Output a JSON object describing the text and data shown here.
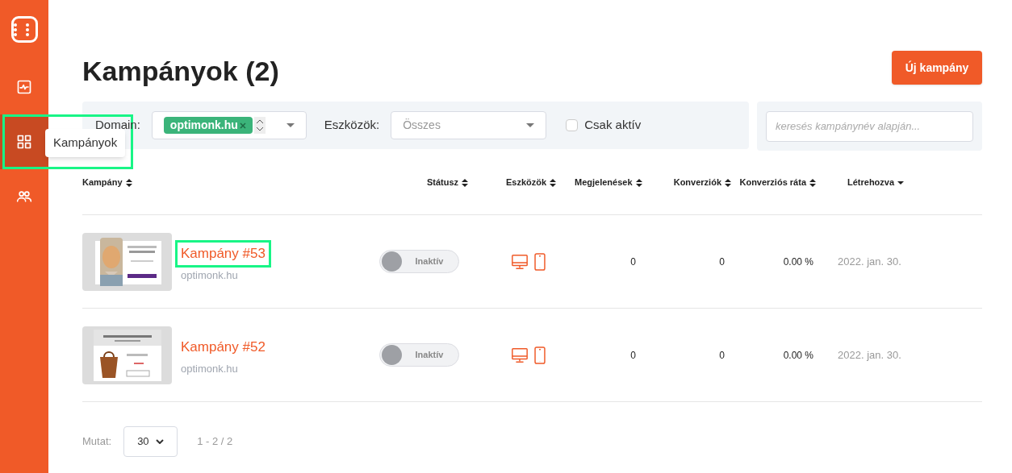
{
  "sidebar": {
    "items": [
      {
        "kind": "analytics",
        "selected": false
      },
      {
        "kind": "campaigns",
        "selected": true
      },
      {
        "kind": "users",
        "selected": false
      }
    ],
    "tooltip": "Kampányok"
  },
  "page": {
    "title": "Kampányok (2)",
    "new_button": "Új kampány"
  },
  "filters": {
    "domain_label": "Domain:",
    "domain_tag": "optimonk.hu",
    "devices_label": "Eszközök:",
    "devices_placeholder": "Összes",
    "only_active": {
      "label": "Csak aktív",
      "checked": false
    },
    "search_placeholder": "keresés kampánynév alapján..."
  },
  "table": {
    "columns": [
      {
        "label": "Kampány",
        "kind": "sortable"
      },
      {
        "label": "Státusz",
        "kind": "sortable"
      },
      {
        "label": "Eszközök",
        "kind": "sortable"
      },
      {
        "label": "Megjelenések",
        "kind": "sortable"
      },
      {
        "label": "Konverziók",
        "kind": "sortable"
      },
      {
        "label": "Konverziós ráta",
        "kind": "sortable"
      },
      {
        "label": "Létrehozva",
        "kind": "sorted"
      }
    ],
    "rows": [
      {
        "name": "Kampány #53",
        "domain": "optimonk.hu",
        "highlighted": true,
        "status": {
          "on": false,
          "label": "Inaktív"
        },
        "devices": [
          {
            "kind": "desktop"
          },
          {
            "kind": "mobile"
          }
        ],
        "impressions": "0",
        "conversions": "0",
        "rate": "0.00 %",
        "created": "2022. jan. 30."
      },
      {
        "name": "Kampány #52",
        "domain": "optimonk.hu",
        "highlighted": false,
        "status": {
          "on": false,
          "label": "Inaktív"
        },
        "devices": [
          {
            "kind": "desktop"
          },
          {
            "kind": "mobile"
          }
        ],
        "impressions": "0",
        "conversions": "0",
        "rate": "0.00 %",
        "created": "2022. jan. 30."
      }
    ]
  },
  "pagination": {
    "label": "Mutat:",
    "per_page": "30",
    "range": "1 - 2 / 2"
  }
}
